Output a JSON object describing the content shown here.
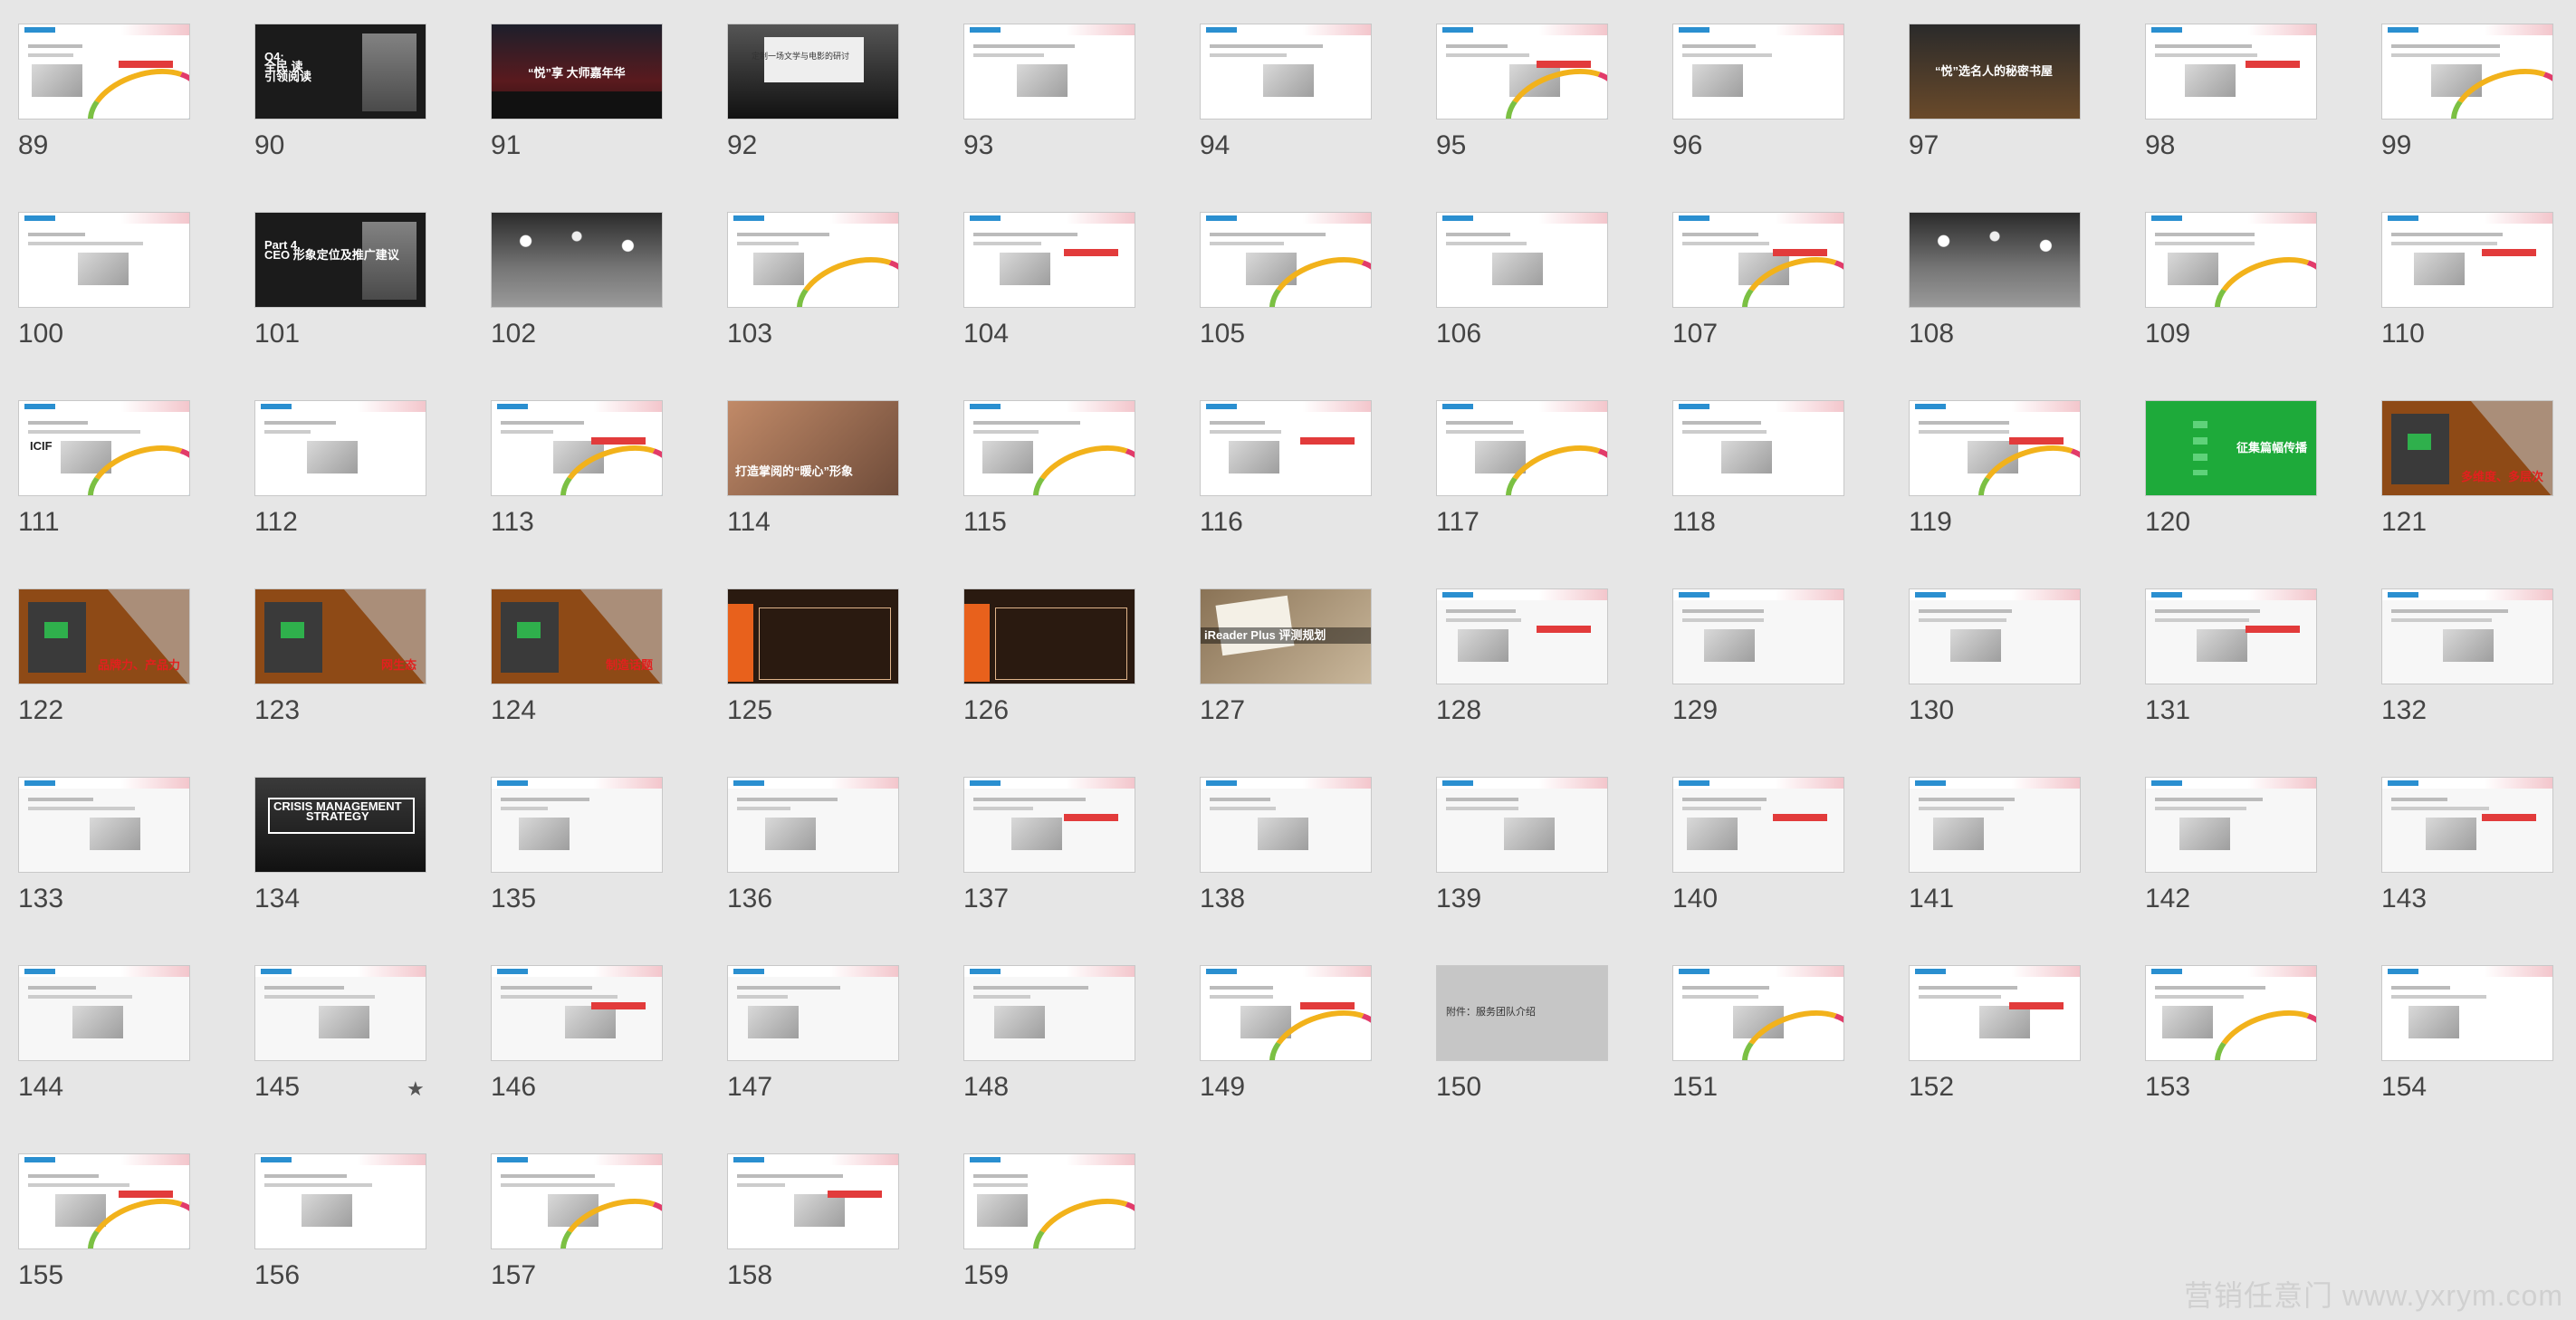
{
  "view": {
    "type": "slide-sorter",
    "selected_marker": "★"
  },
  "slides": [
    {
      "number": "89",
      "theme": "white",
      "title": ""
    },
    {
      "number": "90",
      "theme": "dark",
      "title": "Q4:\n全民 读\n引领阅读"
    },
    {
      "number": "91",
      "theme": "stage",
      "title": "“悦”享 大师嘉年华"
    },
    {
      "number": "92",
      "theme": "cinema",
      "title": "定制一场文学与电影的研讨"
    },
    {
      "number": "93",
      "theme": "red",
      "title": ""
    },
    {
      "number": "94",
      "theme": "white",
      "title": ""
    },
    {
      "number": "95",
      "theme": "white",
      "title": ""
    },
    {
      "number": "96",
      "theme": "white",
      "title": ""
    },
    {
      "number": "97",
      "theme": "library",
      "title": "“悦”选名人的秘密书屋"
    },
    {
      "number": "98",
      "theme": "white",
      "title": ""
    },
    {
      "number": "99",
      "theme": "white",
      "title": ""
    },
    {
      "number": "100",
      "theme": "white",
      "title": ""
    },
    {
      "number": "101",
      "theme": "dark",
      "title": "Part 4.\nCEO 形象定位及推广建议"
    },
    {
      "number": "102",
      "theme": "bokeh",
      "title": ""
    },
    {
      "number": "103",
      "theme": "white",
      "title": ""
    },
    {
      "number": "104",
      "theme": "white",
      "title": ""
    },
    {
      "number": "105",
      "theme": "white",
      "title": ""
    },
    {
      "number": "106",
      "theme": "white",
      "title": ""
    },
    {
      "number": "107",
      "theme": "white",
      "title": ""
    },
    {
      "number": "108",
      "theme": "bokeh",
      "title": ""
    },
    {
      "number": "109",
      "theme": "white",
      "title": ""
    },
    {
      "number": "110",
      "theme": "white",
      "title": ""
    },
    {
      "number": "111",
      "theme": "white",
      "title": "ICIF"
    },
    {
      "number": "112",
      "theme": "white",
      "title": ""
    },
    {
      "number": "113",
      "theme": "white",
      "title": ""
    },
    {
      "number": "114",
      "theme": "hands",
      "title": "打造掌阅的“暖心”形象"
    },
    {
      "number": "115",
      "theme": "white",
      "title": ""
    },
    {
      "number": "116",
      "theme": "white",
      "title": ""
    },
    {
      "number": "117",
      "theme": "white",
      "title": ""
    },
    {
      "number": "118",
      "theme": "white",
      "title": ""
    },
    {
      "number": "119",
      "theme": "white",
      "title": ""
    },
    {
      "number": "120",
      "theme": "green",
      "title": "征集篇幅传播"
    },
    {
      "number": "121",
      "theme": "brown",
      "title": "多维度、多层次"
    },
    {
      "number": "122",
      "theme": "brown",
      "title": "品牌力、产品力"
    },
    {
      "number": "123",
      "theme": "brown",
      "title": "网生态"
    },
    {
      "number": "124",
      "theme": "brown",
      "title": "制造话题"
    },
    {
      "number": "125",
      "theme": "darkbrown",
      "title": ""
    },
    {
      "number": "126",
      "theme": "darkbrown",
      "title": ""
    },
    {
      "number": "127",
      "theme": "wood",
      "title": "iReader Plus 评测规划"
    },
    {
      "number": "128",
      "theme": "light",
      "title": ""
    },
    {
      "number": "129",
      "theme": "light",
      "title": ""
    },
    {
      "number": "130",
      "theme": "light",
      "title": ""
    },
    {
      "number": "131",
      "theme": "light",
      "title": ""
    },
    {
      "number": "132",
      "theme": "light",
      "title": ""
    },
    {
      "number": "133",
      "theme": "light",
      "title": ""
    },
    {
      "number": "134",
      "theme": "crisis",
      "title": "CRISIS MANAGEMENT\nSTRATEGY"
    },
    {
      "number": "135",
      "theme": "light",
      "title": ""
    },
    {
      "number": "136",
      "theme": "light",
      "title": ""
    },
    {
      "number": "137",
      "theme": "light",
      "title": ""
    },
    {
      "number": "138",
      "theme": "light",
      "title": ""
    },
    {
      "number": "139",
      "theme": "light",
      "title": ""
    },
    {
      "number": "140",
      "theme": "light",
      "title": ""
    },
    {
      "number": "141",
      "theme": "light",
      "title": ""
    },
    {
      "number": "142",
      "theme": "light",
      "title": ""
    },
    {
      "number": "143",
      "theme": "light",
      "title": ""
    },
    {
      "number": "144",
      "theme": "light",
      "title": ""
    },
    {
      "number": "145",
      "theme": "light",
      "title": "",
      "starred": true
    },
    {
      "number": "146",
      "theme": "light",
      "title": ""
    },
    {
      "number": "147",
      "theme": "light",
      "title": ""
    },
    {
      "number": "148",
      "theme": "light",
      "title": ""
    },
    {
      "number": "149",
      "theme": "white",
      "title": ""
    },
    {
      "number": "150",
      "theme": "gray",
      "title": "附件：服务团队介绍"
    },
    {
      "number": "151",
      "theme": "white",
      "title": ""
    },
    {
      "number": "152",
      "theme": "white",
      "title": ""
    },
    {
      "number": "153",
      "theme": "white",
      "title": ""
    },
    {
      "number": "154",
      "theme": "white",
      "title": ""
    },
    {
      "number": "155",
      "theme": "white",
      "title": ""
    },
    {
      "number": "156",
      "theme": "white",
      "title": ""
    },
    {
      "number": "157",
      "theme": "white",
      "title": ""
    },
    {
      "number": "158",
      "theme": "white",
      "title": ""
    },
    {
      "number": "159",
      "theme": "white",
      "title": ""
    }
  ],
  "watermark": "营销任意门 www.yxrym.com"
}
